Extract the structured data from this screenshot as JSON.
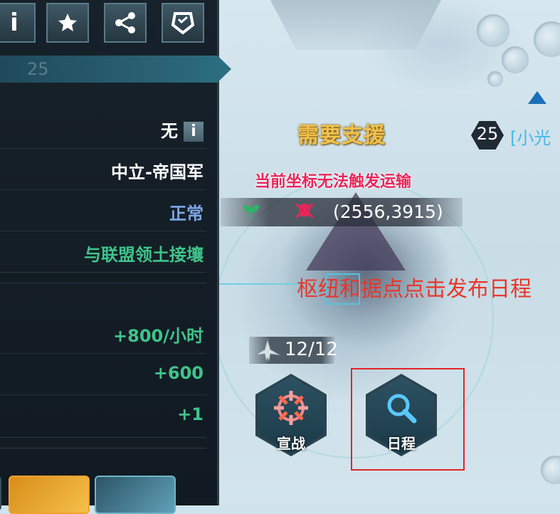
{
  "toolbar": {
    "info_label": "i",
    "buttons": [
      "info-icon",
      "star-icon",
      "share-icon",
      "shield-icon"
    ]
  },
  "panel": {
    "level_ghost": "25",
    "owner_value": "无",
    "info_small": "i",
    "camp_value": "中立-帝国军",
    "state_value": "正常",
    "territory_value": "与联盟领土接壤",
    "output_value": "+800/小时",
    "gain_value": "+600",
    "plus_value": "+1"
  },
  "map": {
    "support_title": "需要支援",
    "transport_warning": "当前坐标无法触发运输",
    "coordinates": "(2556,3915)",
    "hub_note": "枢纽和据点点击发布日程",
    "player_level": "25",
    "player_name": "[小光",
    "troops_count": "12/12",
    "war_button_label": "宣战",
    "schedule_button_label": "日程"
  },
  "colors": {
    "value_white": "#ffffff",
    "value_blue": "#7ea8e8",
    "value_green": "#3fc48a",
    "warning_pink": "#e8265a",
    "annotation_red": "#e0252a",
    "title_gold": "#f2c14a"
  }
}
